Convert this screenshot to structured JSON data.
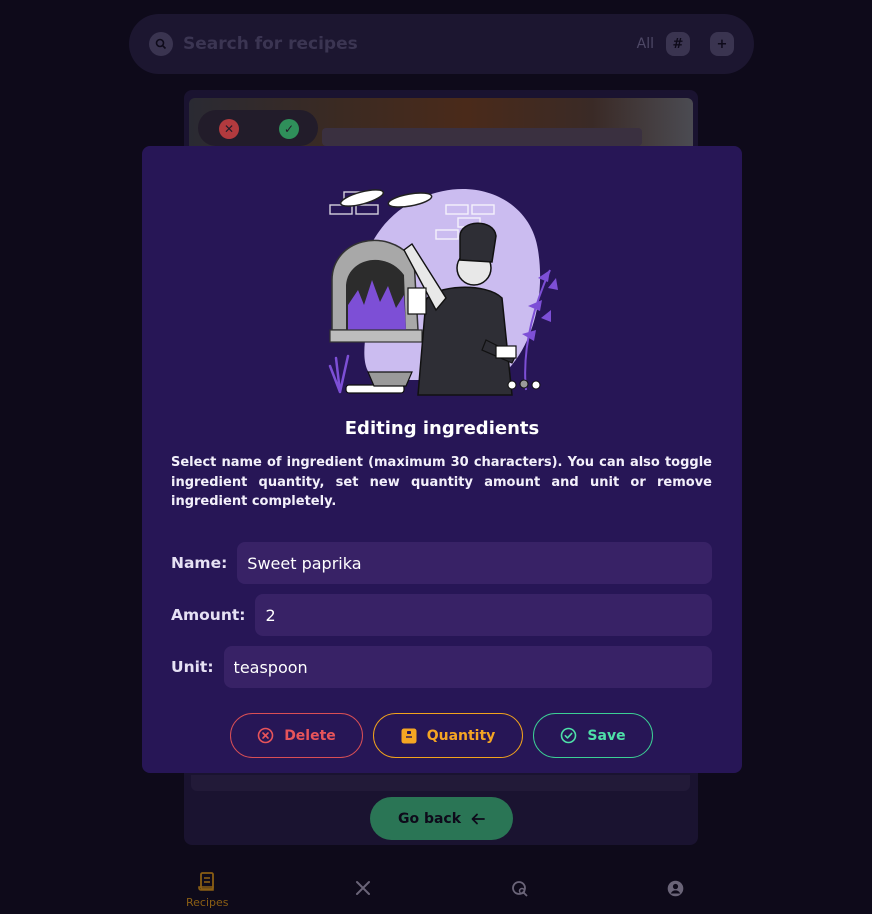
{
  "search": {
    "placeholder": "Search for recipes",
    "filter_label": "All",
    "hash_label": "#",
    "add_label": "+"
  },
  "background": {
    "go_back_label": "Go back"
  },
  "nav": {
    "items": [
      {
        "label": "Recipes",
        "icon": "recipes-icon",
        "active": true
      },
      {
        "label": "",
        "icon": "utensils-icon",
        "active": false
      },
      {
        "label": "",
        "icon": "search-recipe-icon",
        "active": false
      },
      {
        "label": "",
        "icon": "account-icon",
        "active": false
      }
    ]
  },
  "modal": {
    "title": "Editing ingredients",
    "description": "Select name of ingredient (maximum 30 characters). You can also toggle ingredient quantity, set new quantity amount and unit or remove ingredient completely.",
    "fields": {
      "name_label": "Name:",
      "name_value": "Sweet paprika",
      "amount_label": "Amount:",
      "amount_value": "2",
      "unit_label": "Unit:",
      "unit_value": "teaspoon"
    },
    "buttons": {
      "delete": "Delete",
      "quantity": "Quantity",
      "save": "Save"
    }
  },
  "colors": {
    "modal_bg": "#271656",
    "input_bg": "#382266",
    "delete": "#e8545a",
    "quantity": "#f5a623",
    "save": "#4ee0a8",
    "accent_purple": "#7d4fd6"
  }
}
